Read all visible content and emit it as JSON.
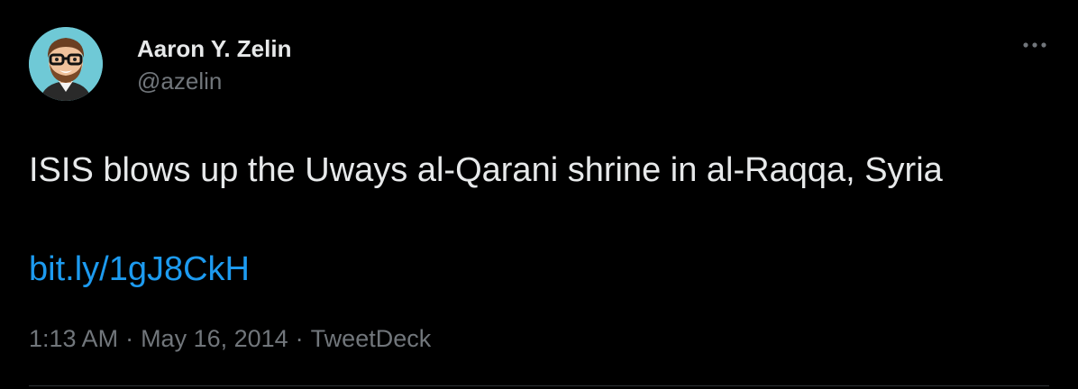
{
  "author": {
    "display_name": "Aaron Y. Zelin",
    "handle": "@azelin"
  },
  "tweet": {
    "text": "ISIS blows up the Uways al-Qarani shrine in al-Raqqa, Syria",
    "link": "bit.ly/1gJ8CkH",
    "time": "1:13 AM",
    "date": "May 16, 2014",
    "separator": "·",
    "source": "TweetDeck"
  },
  "icons": {
    "avatar": "cartoon-avatar",
    "more": "more-horizontal-icon"
  },
  "colors": {
    "background": "#000000",
    "primary_text": "#e7e9ea",
    "secondary_text": "#71767b",
    "link": "#1d9bf0",
    "avatar_bg": "#6fc9d6"
  }
}
